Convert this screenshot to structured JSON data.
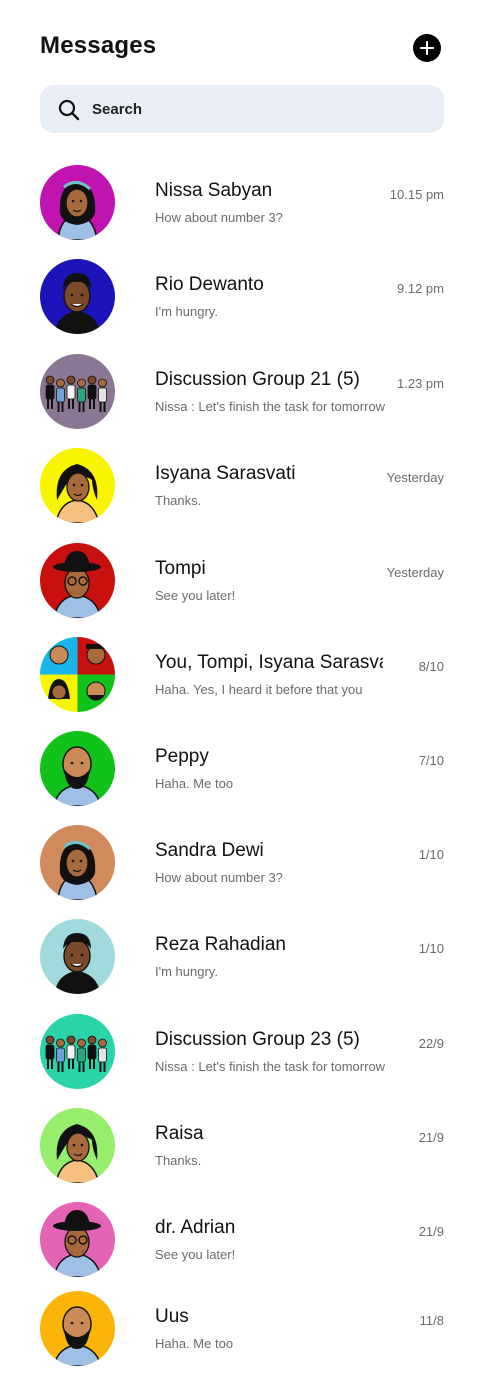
{
  "header": {
    "title": "Messages",
    "add_icon": "plus-icon"
  },
  "search": {
    "placeholder": "Search",
    "value": "",
    "icon": "search-icon"
  },
  "conversations": [
    {
      "name": "Nissa Sabyan",
      "preview": "How about number 3?",
      "time": "10.15 pm",
      "avatar_bg": "#c013b0",
      "avatar_kind": "hijab"
    },
    {
      "name": "Rio Dewanto",
      "preview": "I'm hungry.",
      "time": "9.12 pm",
      "avatar_bg": "#1b14b8",
      "avatar_kind": "man"
    },
    {
      "name": "Discussion Group 21 (5)",
      "preview": "Nissa : Let's finish the task for tomorrow",
      "time": "1.23 pm",
      "avatar_bg": "#8b7794",
      "avatar_kind": "group"
    },
    {
      "name": "Isyana Sarasvati",
      "preview": "Thanks.",
      "time": "Yesterday",
      "avatar_bg": "#f9f500",
      "avatar_kind": "woman"
    },
    {
      "name": "Tompi",
      "preview": "See you later!",
      "time": "Yesterday",
      "avatar_bg": "#c8100f",
      "avatar_kind": "hat"
    },
    {
      "name": "You, Tompi, Isyana Sarasvati",
      "preview": "Haha. Yes, I heard it before that you",
      "time": "8/10",
      "avatar_bg": "#ffffff",
      "avatar_kind": "mosaic"
    },
    {
      "name": "Peppy",
      "preview": "Haha. Me too",
      "time": "7/10",
      "avatar_bg": "#11c21a",
      "avatar_kind": "bald"
    },
    {
      "name": "Sandra Dewi",
      "preview": "How about number 3?",
      "time": "1/10",
      "avatar_bg": "#d08a5c",
      "avatar_kind": "hijab"
    },
    {
      "name": "Reza Rahadian",
      "preview": "I'm hungry.",
      "time": "1/10",
      "avatar_bg": "#a1dadd",
      "avatar_kind": "man"
    },
    {
      "name": "Discussion Group 23 (5)",
      "preview": "Nissa : Let's finish the task for tomorrow",
      "time": "22/9",
      "avatar_bg": "#2ad3a9",
      "avatar_kind": "group"
    },
    {
      "name": "Raisa",
      "preview": "Thanks.",
      "time": "21/9",
      "avatar_bg": "#96ef6c",
      "avatar_kind": "woman"
    },
    {
      "name": "dr. Adrian",
      "preview": "See you later!",
      "time": "21/9",
      "avatar_bg": "#e463b4",
      "avatar_kind": "hat"
    },
    {
      "name": "Uus",
      "preview": "Haha. Me too",
      "time": "11/8",
      "avatar_bg": "#fbb508",
      "avatar_kind": "bald"
    }
  ]
}
